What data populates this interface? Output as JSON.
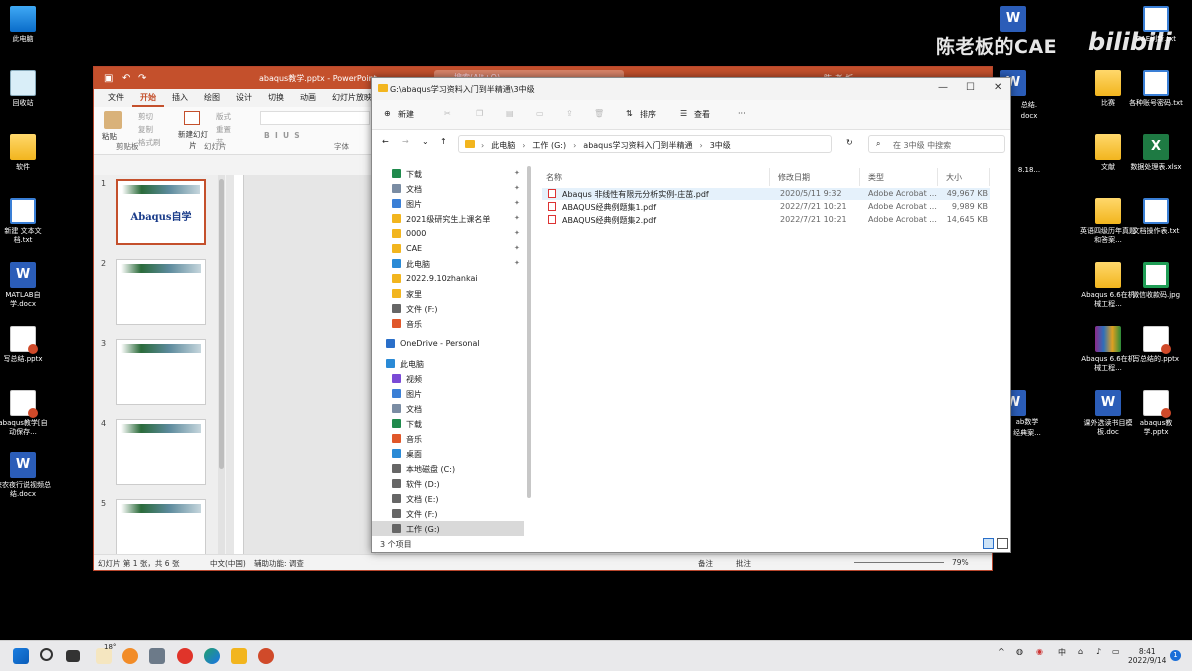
{
  "desktop": {
    "watermark": "陈老板的CAE",
    "watermark_logo": "bilibili",
    "left_icons": [
      {
        "label": "此电脑",
        "icon": "pc-icon"
      },
      {
        "label": "回收站",
        "icon": "recycle-bin-icon"
      },
      {
        "label": "软件",
        "icon": "folder-icon"
      },
      {
        "label": "新建 文本文档.txt",
        "icon": "text-file-icon"
      },
      {
        "label": "MATLAB自学.docx",
        "icon": "word-icon"
      },
      {
        "label": "写总结.pptx",
        "icon": "ppt-icon"
      },
      {
        "label": "abaqus教学[自动保存...",
        "icon": "ppt-icon"
      },
      {
        "label": "狭农夜行说视频总结.docx",
        "icon": "word-icon"
      }
    ],
    "right_icons": [
      {
        "label": "CAE刷新.txt",
        "icon": "text-file-icon"
      },
      {
        "label": "比赛",
        "icon": "folder-icon"
      },
      {
        "label": "各种账号密码.txt",
        "icon": "text-file-icon"
      },
      {
        "label": "文献",
        "icon": "folder-icon"
      },
      {
        "label": "数据处理表.xlsx",
        "icon": "excel-icon"
      },
      {
        "label": "英语四级历年真题和答案...",
        "icon": "folder-icon"
      },
      {
        "label": "文档操作表.txt",
        "icon": "text-file-icon"
      },
      {
        "label": "Abaqus 6.6在机械工程...",
        "icon": "folder-icon"
      },
      {
        "label": "微信收款码.jpg",
        "icon": "qr-icon"
      },
      {
        "label": "Abaqus 6.6在机械工程...",
        "icon": "rar-icon"
      },
      {
        "label": "写总结的.pptx",
        "icon": "ppt-icon"
      },
      {
        "label": "课外选读书目模板.doc",
        "icon": "word-icon"
      },
      {
        "label": "abaqus教学.pptx",
        "icon": "ppt-icon"
      }
    ],
    "partial_labels": [
      "总结.",
      "docx",
      "8.18...",
      "ab数学",
      "经典案..."
    ]
  },
  "ppt": {
    "title": "abaqus教学.pptx  -  PowerPoint",
    "search_placeholder": "搜索(Alt+Q)",
    "user": "陈 老 板",
    "menu": [
      "文件",
      "开始",
      "插入",
      "绘图",
      "设计",
      "切换",
      "动画",
      "幻灯片放映"
    ],
    "ribbon": {
      "paste": "粘贴",
      "cut": "剪切",
      "copy": "复制",
      "format_painter": "格式刷",
      "clipboard": "剪贴板",
      "new_slide": "新建幻灯片",
      "layout": "版式",
      "reset": "重置",
      "section": "节",
      "slides_group": "幻灯片",
      "font_group": "字体"
    },
    "slides": [
      {
        "num": "1",
        "title": "Abaqus自学"
      },
      {
        "num": "2",
        "title": ""
      },
      {
        "num": "3",
        "title": ""
      },
      {
        "num": "4",
        "title": ""
      },
      {
        "num": "5",
        "title": ""
      }
    ],
    "status": {
      "slide_of": "幻灯片 第 1 张，共 6 张",
      "lang": "中文(中国)",
      "accessibility": "辅助功能: 调查",
      "notes": "备注",
      "comments": "批注",
      "zoom": "79%"
    }
  },
  "explorer": {
    "title": "G:\\abaqus学习资料入门到半精通\\3中级",
    "toolbar": {
      "new": "新建",
      "sort": "排序",
      "view": "查看",
      "more": "···"
    },
    "address": [
      "此电脑",
      "工作 (G:)",
      "abaqus学习资料入门到半精通",
      "3中级"
    ],
    "search_placeholder": "在 3中级 中搜索",
    "nav": [
      {
        "label": "下载",
        "icon": "download-icon",
        "pin": true,
        "color": "#1f8a4c"
      },
      {
        "label": "文档",
        "icon": "document-icon",
        "pin": true,
        "color": "#7a8ca3"
      },
      {
        "label": "图片",
        "icon": "pictures-icon",
        "pin": true,
        "color": "#3a7fd6"
      },
      {
        "label": "2021级研究生上课名单",
        "icon": "folder-icon",
        "pin": true,
        "color": "#f2b51e"
      },
      {
        "label": "0000",
        "icon": "folder-icon",
        "pin": true,
        "color": "#f2b51e"
      },
      {
        "label": "CAE",
        "icon": "folder-icon",
        "pin": true,
        "color": "#f2b51e"
      },
      {
        "label": "此电脑",
        "icon": "pc-icon",
        "pin": true,
        "color": "#2a8ad6"
      },
      {
        "label": "2022.9.10zhankai",
        "icon": "folder-icon",
        "pin": false,
        "color": "#f2b51e"
      },
      {
        "label": "家里",
        "icon": "folder-icon",
        "pin": false,
        "color": "#f2b51e"
      },
      {
        "label": "文件 (F:)",
        "icon": "drive-icon",
        "pin": false,
        "color": "#666"
      },
      {
        "label": "音乐",
        "icon": "music-icon",
        "pin": false,
        "color": "#e0572a"
      },
      {
        "label": "OneDrive - Personal",
        "icon": "cloud-icon",
        "pin": false,
        "color": "#2a6fc9"
      },
      {
        "label": "此电脑",
        "icon": "pc-icon",
        "pin": false,
        "color": "#2a8ad6"
      },
      {
        "label": "视频",
        "icon": "video-icon",
        "pin": false,
        "color": "#7a4ad6"
      },
      {
        "label": "图片",
        "icon": "pictures-icon",
        "pin": false,
        "color": "#3a7fd6"
      },
      {
        "label": "文档",
        "icon": "document-icon",
        "pin": false,
        "color": "#7a8ca3"
      },
      {
        "label": "下载",
        "icon": "download-icon",
        "pin": false,
        "color": "#1f8a4c"
      },
      {
        "label": "音乐",
        "icon": "music-icon",
        "pin": false,
        "color": "#e0572a"
      },
      {
        "label": "桌面",
        "icon": "desktop-icon",
        "pin": false,
        "color": "#2a8ad6"
      },
      {
        "label": "本地磁盘 (C:)",
        "icon": "drive-icon",
        "pin": false,
        "color": "#666"
      },
      {
        "label": "软件 (D:)",
        "icon": "drive-icon",
        "pin": false,
        "color": "#666"
      },
      {
        "label": "文档 (E:)",
        "icon": "drive-icon",
        "pin": false,
        "color": "#666"
      },
      {
        "label": "文件 (F:)",
        "icon": "drive-icon",
        "pin": false,
        "color": "#666"
      },
      {
        "label": "工作 (G:)",
        "icon": "drive-icon",
        "pin": false,
        "color": "#666"
      }
    ],
    "columns": [
      "名称",
      "修改日期",
      "类型",
      "大小"
    ],
    "files": [
      {
        "name": "Abaqus 非线性有限元分析实例-庄茁.pdf",
        "date": "2020/5/11 9:32",
        "type": "Adobe Acrobat ...",
        "size": "49,967 KB"
      },
      {
        "name": "ABAQUS经典例题集1.pdf",
        "date": "2022/7/21 10:21",
        "type": "Adobe Acrobat ...",
        "size": "9,989 KB"
      },
      {
        "name": "ABAQUS经典例题集2.pdf",
        "date": "2022/7/21 10:21",
        "type": "Adobe Acrobat ...",
        "size": "14,645 KB"
      }
    ],
    "status": "3 个项目"
  },
  "taskbar": {
    "weather": "18°",
    "time": "8:41",
    "date": "2022/9/14",
    "notification_count": "1"
  }
}
